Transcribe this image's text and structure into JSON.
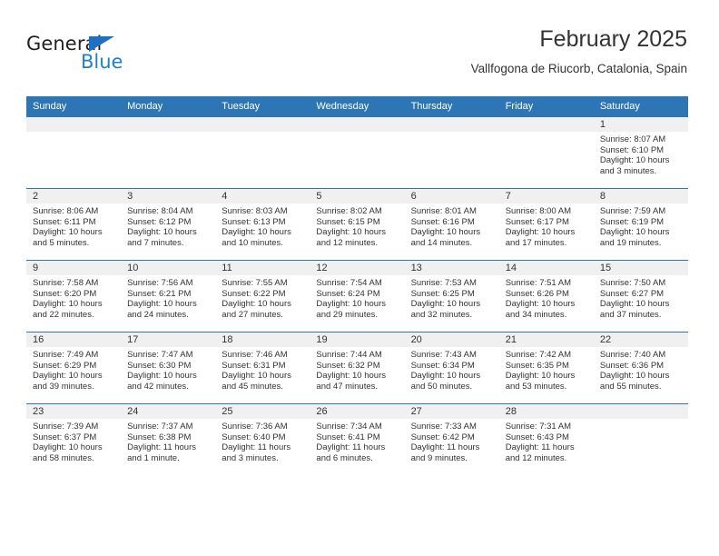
{
  "brand": {
    "name_part1": "General",
    "name_part2": "Blue",
    "accent_color": "#1f7fd0",
    "triangle_color": "#1f6fc4"
  },
  "header": {
    "title": "February 2025",
    "subtitle": "Vallfogona de Riucorb, Catalonia, Spain"
  },
  "theme": {
    "header_bg": "#2e75b6",
    "date_strip_bg": "#f0f0f0",
    "text_color": "#333333"
  },
  "weekdays": [
    "Sunday",
    "Monday",
    "Tuesday",
    "Wednesday",
    "Thursday",
    "Friday",
    "Saturday"
  ],
  "weeks": [
    [
      {
        "day": "",
        "sunrise": "",
        "sunset": "",
        "daylight1": "",
        "daylight2": "",
        "empty": true
      },
      {
        "day": "",
        "sunrise": "",
        "sunset": "",
        "daylight1": "",
        "daylight2": "",
        "empty": true
      },
      {
        "day": "",
        "sunrise": "",
        "sunset": "",
        "daylight1": "",
        "daylight2": "",
        "empty": true
      },
      {
        "day": "",
        "sunrise": "",
        "sunset": "",
        "daylight1": "",
        "daylight2": "",
        "empty": true
      },
      {
        "day": "",
        "sunrise": "",
        "sunset": "",
        "daylight1": "",
        "daylight2": "",
        "empty": true
      },
      {
        "day": "",
        "sunrise": "",
        "sunset": "",
        "daylight1": "",
        "daylight2": "",
        "empty": true
      },
      {
        "day": "1",
        "sunrise": "Sunrise: 8:07 AM",
        "sunset": "Sunset: 6:10 PM",
        "daylight1": "Daylight: 10 hours",
        "daylight2": "and 3 minutes.",
        "empty": false
      }
    ],
    [
      {
        "day": "2",
        "sunrise": "Sunrise: 8:06 AM",
        "sunset": "Sunset: 6:11 PM",
        "daylight1": "Daylight: 10 hours",
        "daylight2": "and 5 minutes.",
        "empty": false
      },
      {
        "day": "3",
        "sunrise": "Sunrise: 8:04 AM",
        "sunset": "Sunset: 6:12 PM",
        "daylight1": "Daylight: 10 hours",
        "daylight2": "and 7 minutes.",
        "empty": false
      },
      {
        "day": "4",
        "sunrise": "Sunrise: 8:03 AM",
        "sunset": "Sunset: 6:13 PM",
        "daylight1": "Daylight: 10 hours",
        "daylight2": "and 10 minutes.",
        "empty": false
      },
      {
        "day": "5",
        "sunrise": "Sunrise: 8:02 AM",
        "sunset": "Sunset: 6:15 PM",
        "daylight1": "Daylight: 10 hours",
        "daylight2": "and 12 minutes.",
        "empty": false
      },
      {
        "day": "6",
        "sunrise": "Sunrise: 8:01 AM",
        "sunset": "Sunset: 6:16 PM",
        "daylight1": "Daylight: 10 hours",
        "daylight2": "and 14 minutes.",
        "empty": false
      },
      {
        "day": "7",
        "sunrise": "Sunrise: 8:00 AM",
        "sunset": "Sunset: 6:17 PM",
        "daylight1": "Daylight: 10 hours",
        "daylight2": "and 17 minutes.",
        "empty": false
      },
      {
        "day": "8",
        "sunrise": "Sunrise: 7:59 AM",
        "sunset": "Sunset: 6:19 PM",
        "daylight1": "Daylight: 10 hours",
        "daylight2": "and 19 minutes.",
        "empty": false
      }
    ],
    [
      {
        "day": "9",
        "sunrise": "Sunrise: 7:58 AM",
        "sunset": "Sunset: 6:20 PM",
        "daylight1": "Daylight: 10 hours",
        "daylight2": "and 22 minutes.",
        "empty": false
      },
      {
        "day": "10",
        "sunrise": "Sunrise: 7:56 AM",
        "sunset": "Sunset: 6:21 PM",
        "daylight1": "Daylight: 10 hours",
        "daylight2": "and 24 minutes.",
        "empty": false
      },
      {
        "day": "11",
        "sunrise": "Sunrise: 7:55 AM",
        "sunset": "Sunset: 6:22 PM",
        "daylight1": "Daylight: 10 hours",
        "daylight2": "and 27 minutes.",
        "empty": false
      },
      {
        "day": "12",
        "sunrise": "Sunrise: 7:54 AM",
        "sunset": "Sunset: 6:24 PM",
        "daylight1": "Daylight: 10 hours",
        "daylight2": "and 29 minutes.",
        "empty": false
      },
      {
        "day": "13",
        "sunrise": "Sunrise: 7:53 AM",
        "sunset": "Sunset: 6:25 PM",
        "daylight1": "Daylight: 10 hours",
        "daylight2": "and 32 minutes.",
        "empty": false
      },
      {
        "day": "14",
        "sunrise": "Sunrise: 7:51 AM",
        "sunset": "Sunset: 6:26 PM",
        "daylight1": "Daylight: 10 hours",
        "daylight2": "and 34 minutes.",
        "empty": false
      },
      {
        "day": "15",
        "sunrise": "Sunrise: 7:50 AM",
        "sunset": "Sunset: 6:27 PM",
        "daylight1": "Daylight: 10 hours",
        "daylight2": "and 37 minutes.",
        "empty": false
      }
    ],
    [
      {
        "day": "16",
        "sunrise": "Sunrise: 7:49 AM",
        "sunset": "Sunset: 6:29 PM",
        "daylight1": "Daylight: 10 hours",
        "daylight2": "and 39 minutes.",
        "empty": false
      },
      {
        "day": "17",
        "sunrise": "Sunrise: 7:47 AM",
        "sunset": "Sunset: 6:30 PM",
        "daylight1": "Daylight: 10 hours",
        "daylight2": "and 42 minutes.",
        "empty": false
      },
      {
        "day": "18",
        "sunrise": "Sunrise: 7:46 AM",
        "sunset": "Sunset: 6:31 PM",
        "daylight1": "Daylight: 10 hours",
        "daylight2": "and 45 minutes.",
        "empty": false
      },
      {
        "day": "19",
        "sunrise": "Sunrise: 7:44 AM",
        "sunset": "Sunset: 6:32 PM",
        "daylight1": "Daylight: 10 hours",
        "daylight2": "and 47 minutes.",
        "empty": false
      },
      {
        "day": "20",
        "sunrise": "Sunrise: 7:43 AM",
        "sunset": "Sunset: 6:34 PM",
        "daylight1": "Daylight: 10 hours",
        "daylight2": "and 50 minutes.",
        "empty": false
      },
      {
        "day": "21",
        "sunrise": "Sunrise: 7:42 AM",
        "sunset": "Sunset: 6:35 PM",
        "daylight1": "Daylight: 10 hours",
        "daylight2": "and 53 minutes.",
        "empty": false
      },
      {
        "day": "22",
        "sunrise": "Sunrise: 7:40 AM",
        "sunset": "Sunset: 6:36 PM",
        "daylight1": "Daylight: 10 hours",
        "daylight2": "and 55 minutes.",
        "empty": false
      }
    ],
    [
      {
        "day": "23",
        "sunrise": "Sunrise: 7:39 AM",
        "sunset": "Sunset: 6:37 PM",
        "daylight1": "Daylight: 10 hours",
        "daylight2": "and 58 minutes.",
        "empty": false
      },
      {
        "day": "24",
        "sunrise": "Sunrise: 7:37 AM",
        "sunset": "Sunset: 6:38 PM",
        "daylight1": "Daylight: 11 hours",
        "daylight2": "and 1 minute.",
        "empty": false
      },
      {
        "day": "25",
        "sunrise": "Sunrise: 7:36 AM",
        "sunset": "Sunset: 6:40 PM",
        "daylight1": "Daylight: 11 hours",
        "daylight2": "and 3 minutes.",
        "empty": false
      },
      {
        "day": "26",
        "sunrise": "Sunrise: 7:34 AM",
        "sunset": "Sunset: 6:41 PM",
        "daylight1": "Daylight: 11 hours",
        "daylight2": "and 6 minutes.",
        "empty": false
      },
      {
        "day": "27",
        "sunrise": "Sunrise: 7:33 AM",
        "sunset": "Sunset: 6:42 PM",
        "daylight1": "Daylight: 11 hours",
        "daylight2": "and 9 minutes.",
        "empty": false
      },
      {
        "day": "28",
        "sunrise": "Sunrise: 7:31 AM",
        "sunset": "Sunset: 6:43 PM",
        "daylight1": "Daylight: 11 hours",
        "daylight2": "and 12 minutes.",
        "empty": false
      },
      {
        "day": "",
        "sunrise": "",
        "sunset": "",
        "daylight1": "",
        "daylight2": "",
        "empty": true
      }
    ]
  ]
}
